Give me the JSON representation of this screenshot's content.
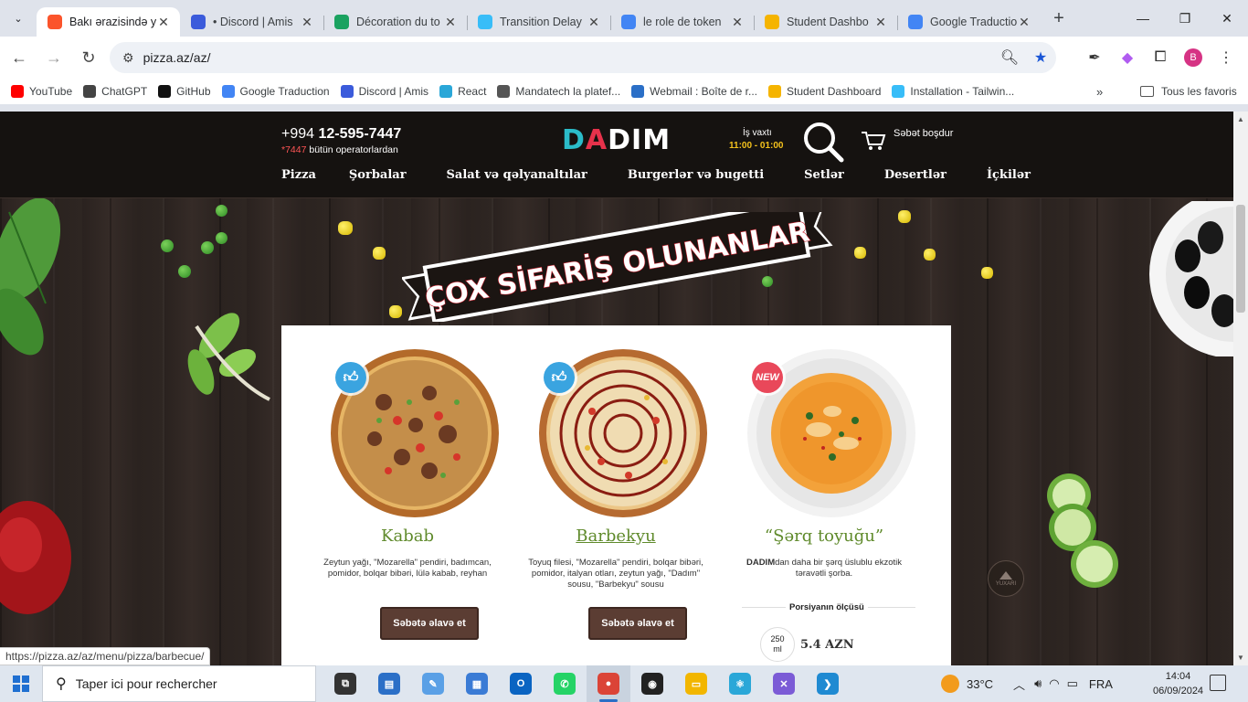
{
  "browser": {
    "tabs": [
      {
        "title": "Bakı ərazisində y",
        "icon": "brave-lion-icon",
        "color": "#fb542b",
        "active": true
      },
      {
        "title": "• Discord | Amis",
        "icon": "discord-icon",
        "color": "#3b5bdb",
        "active": false
      },
      {
        "title": "Décoration du to",
        "icon": "dribbble-d-icon",
        "color": "#1aa260",
        "active": false
      },
      {
        "title": "Transition Delay",
        "icon": "tailwind-icon",
        "color": "#38bdf8",
        "active": false
      },
      {
        "title": "le role de token",
        "icon": "google-g-icon",
        "color": "#4285f4",
        "active": false
      },
      {
        "title": "Student Dashbo",
        "icon": "student-chevron-icon",
        "color": "#f5b400",
        "active": false
      },
      {
        "title": "Google Traductio",
        "icon": "google-translate-icon",
        "color": "#4285f4",
        "active": false
      }
    ],
    "url": "pizza.az/az/",
    "bookmarks": [
      {
        "label": "YouTube",
        "icon": "youtube-icon",
        "color": "#ff0000"
      },
      {
        "label": "ChatGPT",
        "icon": "chatgpt-icon",
        "color": "#444444"
      },
      {
        "label": "GitHub",
        "icon": "github-icon",
        "color": "#111111"
      },
      {
        "label": "Google Traduction",
        "icon": "google-translate-icon",
        "color": "#4285f4"
      },
      {
        "label": "Discord | Amis",
        "icon": "discord-icon",
        "color": "#3b5bdb"
      },
      {
        "label": "React",
        "icon": "react-icon",
        "color": "#2aa7d8"
      },
      {
        "label": "Mandatech la platef...",
        "icon": "globe-icon",
        "color": "#555555"
      },
      {
        "label": "Webmail : Boîte de r...",
        "icon": "webmail-icon",
        "color": "#2b6fc7"
      },
      {
        "label": "Student Dashboard",
        "icon": "student-chevron-icon",
        "color": "#f5b400"
      },
      {
        "label": "Installation - Tailwin...",
        "icon": "tailwind-icon",
        "color": "#38bdf8"
      }
    ],
    "bookmarks_more": "»",
    "all_bookmarks": "Tous les favoris",
    "profile_initial": "B",
    "status_url": "https://pizza.az/az/menu/pizza/barbecue/"
  },
  "site": {
    "phone_prefix": "+994",
    "phone_number": "12-595-7447",
    "phone_short": "*7447",
    "phone_sub": "bütün operatorlardan",
    "logo": {
      "d": "D",
      "a": "A",
      "rest": "DIM"
    },
    "hours_label": "İş vaxtı",
    "hours": "11:00 - 01:00",
    "cart_text": "Səbət boşdur",
    "nav": [
      "Pizza",
      "Şorbalar",
      "Salat və qəlyanaltılar",
      "Burgerlər və bugetti",
      "Setlər",
      "Desertlər",
      "İçkilər"
    ],
    "banner": "ÇOX SİFARİŞ OLUNANLAR",
    "to_top": "YUXARI",
    "products": [
      {
        "name": "Kabab",
        "badge": "like",
        "description": "Zeytun yağı, \"Mozarella\" pendiri, badımcan, pomidor, bolqar bibəri, lülə kabab, reyhan",
        "button": "Səbətə əlavə et"
      },
      {
        "name": "Barbekyu",
        "badge": "like",
        "description": "Toyuq filesi, \"Mozarella\" pendiri, bolqar bibəri, pomidor, italyan otları, zeytun yağı, \"Dadım\" sousu, \"Barbekyu\" sousu",
        "button": "Səbətə əlavə et"
      },
      {
        "name": "“Şərq toyuğu”",
        "badge": "NEW",
        "description_bold": "DADIM",
        "description": "dan daha bir şərq üslublu ekzotik təravətli şorba.",
        "portion_label": "Porsiyanın ölçüsü",
        "size_value": "250",
        "size_unit": "ml",
        "price": "5.4 AZN"
      }
    ]
  },
  "taskbar": {
    "search_placeholder": "Taper ici pour rechercher",
    "apps": [
      {
        "name": "task-view-icon",
        "color": "#333333",
        "glyph": "⧉"
      },
      {
        "name": "network-app-icon",
        "color": "#2b6fc7",
        "glyph": "▤"
      },
      {
        "name": "paint-icon",
        "color": "#5aa0e6",
        "glyph": "✎"
      },
      {
        "name": "calculator-icon",
        "color": "#3a7bd5",
        "glyph": "▦"
      },
      {
        "name": "outlook-icon",
        "color": "#0a64c2",
        "glyph": "O"
      },
      {
        "name": "whatsapp-icon",
        "color": "#25d366",
        "glyph": "✆"
      },
      {
        "name": "chrome-icon",
        "color": "#db4437",
        "glyph": "●"
      },
      {
        "name": "github-desktop-icon",
        "color": "#222222",
        "glyph": "◉"
      },
      {
        "name": "file-explorer-icon",
        "color": "#f2b600",
        "glyph": "▭"
      },
      {
        "name": "react-devtools-icon",
        "color": "#2aa7d8",
        "glyph": "⚛"
      },
      {
        "name": "visual-studio-icon",
        "color": "#7b5bd6",
        "glyph": "✕"
      },
      {
        "name": "vscode-icon",
        "color": "#1f8ad2",
        "glyph": "❯"
      }
    ],
    "active_app": 6,
    "weather": "33°C",
    "language": "FRA",
    "time": "14:04",
    "date": "06/09/2024"
  }
}
